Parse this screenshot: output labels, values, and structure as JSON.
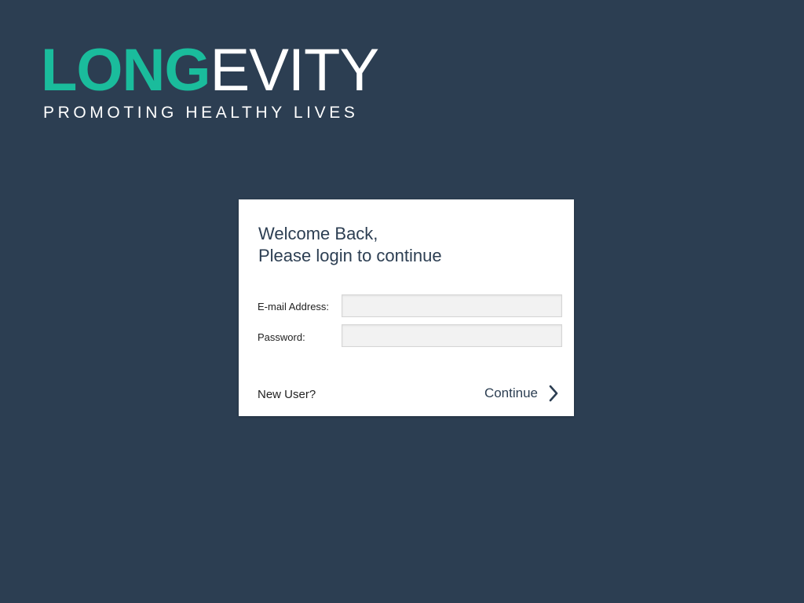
{
  "brand": {
    "logo_part_a": "LONG",
    "logo_part_b": "EVITY",
    "tagline": "PROMOTING HEALTHY LIVES",
    "accent_color": "#1abc9c",
    "background_color": "#2c3e52"
  },
  "login": {
    "welcome_line1": "Welcome Back,",
    "welcome_line2": "Please login to continue",
    "email_label": "E-mail Address:",
    "email_value": "",
    "password_label": "Password:",
    "password_value": "",
    "new_user_label": "New User?",
    "continue_label": "Continue",
    "continue_icon": "chevron-right-icon"
  }
}
